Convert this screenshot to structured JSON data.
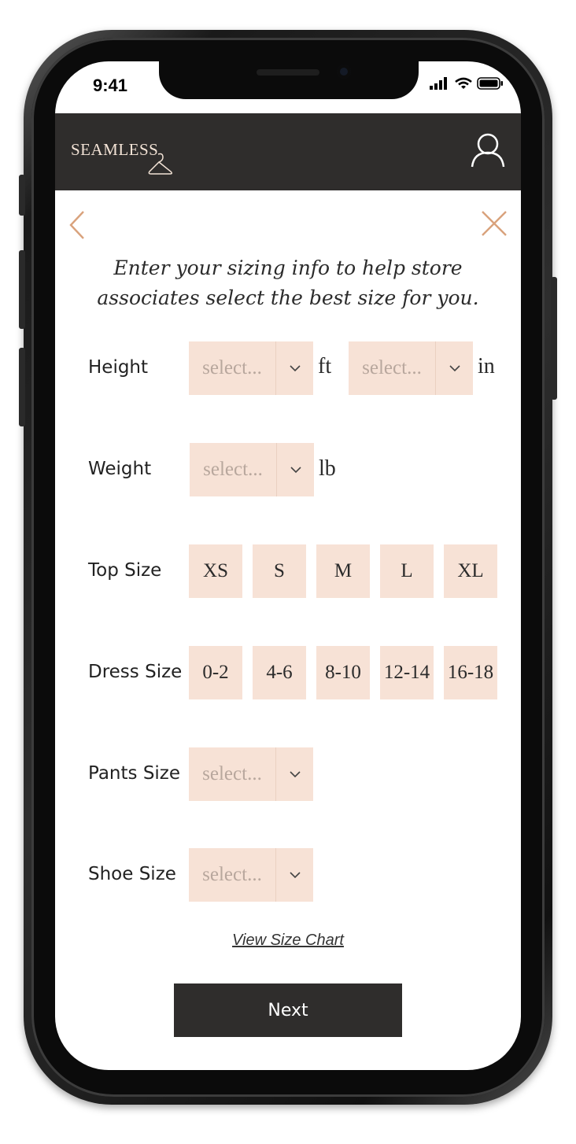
{
  "status_bar": {
    "time": "9:41"
  },
  "header": {
    "logo_text": "SEAMLESS",
    "profile_icon": "user-icon"
  },
  "intro": "Enter your sizing info to help store associates select the best size for you.",
  "form": {
    "height": {
      "label": "Height",
      "feet": {
        "placeholder": "select...",
        "unit": "ft"
      },
      "inches": {
        "placeholder": "select...",
        "unit": "in"
      }
    },
    "weight": {
      "label": "Weight",
      "placeholder": "select...",
      "unit": "lb"
    },
    "top_size": {
      "label": "Top Size",
      "options": [
        "XS",
        "S",
        "M",
        "L",
        "XL"
      ]
    },
    "dress_size": {
      "label": "Dress Size",
      "options": [
        "0-2",
        "4-6",
        "8-10",
        "12-14",
        "16-18"
      ]
    },
    "pants_size": {
      "label": "Pants Size",
      "placeholder": "select..."
    },
    "shoe_size": {
      "label": "Shoe Size",
      "placeholder": "select..."
    }
  },
  "links": {
    "size_chart": "View Size Chart"
  },
  "buttons": {
    "next": "Next"
  },
  "colors": {
    "header_bg": "#2f2d2c",
    "field_bg": "#f7e2d6",
    "accent": "#d9a27c",
    "placeholder_text": "#b8a79d"
  }
}
